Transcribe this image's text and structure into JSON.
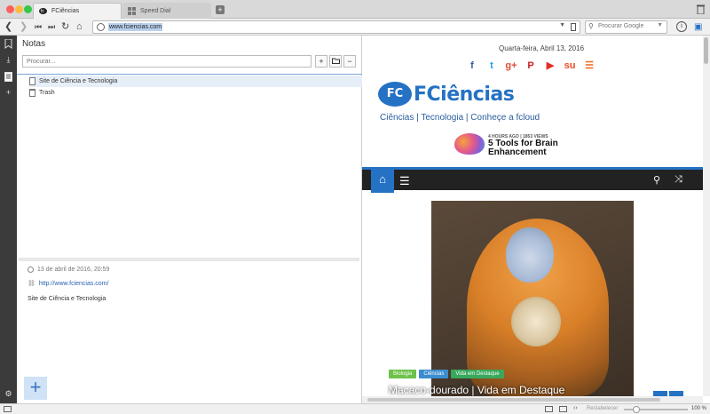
{
  "tabs": [
    {
      "label": "FCiências",
      "active": true
    },
    {
      "label": "Speed Dial",
      "active": false
    }
  ],
  "newtab_label": "+",
  "address": {
    "url": "www.fciencias.com",
    "search_placeholder": "Procurar Google"
  },
  "notes": {
    "title": "Notas",
    "search_placeholder": "Procurar...",
    "tools": [
      "+",
      "folder",
      "−"
    ],
    "items": [
      {
        "label": "Site de Ciência e Tecnologia",
        "type": "note",
        "selected": true
      },
      {
        "label": "Trash",
        "type": "trash",
        "selected": false
      }
    ],
    "detail": {
      "date": "13 de abril de 2016, 20:59",
      "link": "http://www.fciencias.com/",
      "text": "Site de Ciência e Tecnologia"
    },
    "add_label": "+"
  },
  "web": {
    "date": "Quarta-feira, Abril 13, 2016",
    "social": [
      {
        "icon": "facebook-icon",
        "glyph": "f",
        "color": "#3b5998"
      },
      {
        "icon": "twitter-icon",
        "glyph": "t",
        "color": "#1da1f2"
      },
      {
        "icon": "googleplus-icon",
        "glyph": "g+",
        "color": "#dd4b39"
      },
      {
        "icon": "pinterest-icon",
        "glyph": "P",
        "color": "#cb2027"
      },
      {
        "icon": "youtube-icon",
        "glyph": "▶",
        "color": "#e52d27"
      },
      {
        "icon": "stumbleupon-icon",
        "glyph": "su",
        "color": "#eb4924"
      },
      {
        "icon": "rss-icon",
        "glyph": "☰",
        "color": "#f26522"
      }
    ],
    "logo_badge": "FC",
    "logo_text": "FCiências",
    "tagline": "Ciências | Tecnologia | Conheçe a fcloud",
    "promo_meta": "4 HOURS AGO | 1853 VIEWS",
    "promo_title_line1": "5 Tools for Brain",
    "promo_title_line2": "Enhancement",
    "hero_tags": [
      {
        "label": "Biologia",
        "color": "#6cc24a"
      },
      {
        "label": "Ciências",
        "color": "#3c8dcf"
      },
      {
        "label": "Vida em Destaque",
        "color": "#3aa85c"
      }
    ],
    "hero_caption": "Macaco-dourado | Vida em Destaque"
  },
  "status": {
    "reset_label": "Restabelecer",
    "zoom": "100 %",
    "zoom_level": 0.2
  }
}
